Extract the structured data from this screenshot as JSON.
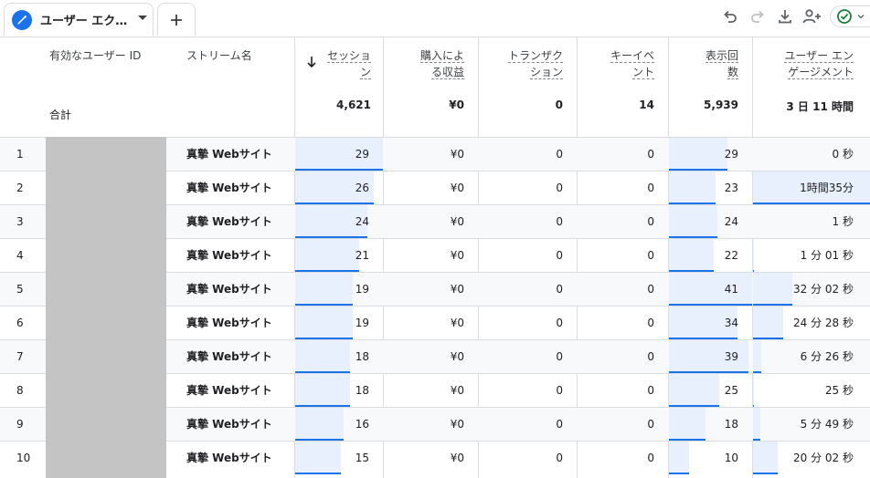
{
  "tab": {
    "label": "ユーザー エク…",
    "add_label": "+"
  },
  "toolbar": {
    "icons": [
      "undo-icon",
      "redo-icon",
      "download-icon",
      "share-user-icon",
      "check-circle-icon"
    ]
  },
  "colors": {
    "accent": "#1a73e8",
    "bar_fill": "#e8f0fe",
    "grid": "#dadce0",
    "redact": "#c4c4c4",
    "check": "#188038"
  },
  "headers": {
    "user_id": "有効なユーザー ID",
    "stream": "ストリーム名",
    "sessions": [
      "セッショ",
      "ン"
    ],
    "revenue": [
      "購入によ",
      "る収益"
    ],
    "transactions": [
      "トランザク",
      "ション"
    ],
    "key_events": [
      "キーイベ",
      "ント"
    ],
    "views": [
      "表示回",
      "数"
    ],
    "engagement": [
      "ユーザー エン",
      "ゲージメント"
    ]
  },
  "totals": {
    "label": "合計",
    "sessions": "4,621",
    "revenue": "¥0",
    "transactions": "0",
    "key_events": "14",
    "views": "5,939",
    "engagement": "3 日 11 時間"
  },
  "rows": [
    {
      "index": "1",
      "stream": "真摯 Webサイト",
      "sessions": "29",
      "revenue": "¥0",
      "transactions": "0",
      "key_events": "0",
      "views": "29",
      "engagement": "0 秒",
      "sessions_n": 29,
      "views_n": 29,
      "engagement_sec": 0
    },
    {
      "index": "2",
      "stream": "真摯 Webサイト",
      "sessions": "26",
      "revenue": "¥0",
      "transactions": "0",
      "key_events": "0",
      "views": "23",
      "engagement": "1時間35分",
      "sessions_n": 26,
      "views_n": 23,
      "engagement_sec": 5700
    },
    {
      "index": "3",
      "stream": "真摯 Webサイト",
      "sessions": "24",
      "revenue": "¥0",
      "transactions": "0",
      "key_events": "0",
      "views": "24",
      "engagement": "1 秒",
      "sessions_n": 24,
      "views_n": 24,
      "engagement_sec": 1
    },
    {
      "index": "4",
      "stream": "真摯 Webサイト",
      "sessions": "21",
      "revenue": "¥0",
      "transactions": "0",
      "key_events": "0",
      "views": "22",
      "engagement": "1 分 01 秒",
      "sessions_n": 21,
      "views_n": 22,
      "engagement_sec": 61
    },
    {
      "index": "5",
      "stream": "真摯 Webサイト",
      "sessions": "19",
      "revenue": "¥0",
      "transactions": "0",
      "key_events": "0",
      "views": "41",
      "engagement": "32 分 02 秒",
      "sessions_n": 19,
      "views_n": 41,
      "engagement_sec": 1922
    },
    {
      "index": "6",
      "stream": "真摯 Webサイト",
      "sessions": "19",
      "revenue": "¥0",
      "transactions": "0",
      "key_events": "0",
      "views": "34",
      "engagement": "24 分 28 秒",
      "sessions_n": 19,
      "views_n": 34,
      "engagement_sec": 1468
    },
    {
      "index": "7",
      "stream": "真摯 Webサイト",
      "sessions": "18",
      "revenue": "¥0",
      "transactions": "0",
      "key_events": "0",
      "views": "39",
      "engagement": "6 分 26 秒",
      "sessions_n": 18,
      "views_n": 39,
      "engagement_sec": 386
    },
    {
      "index": "8",
      "stream": "真摯 Webサイト",
      "sessions": "18",
      "revenue": "¥0",
      "transactions": "0",
      "key_events": "0",
      "views": "25",
      "engagement": "25 秒",
      "sessions_n": 18,
      "views_n": 25,
      "engagement_sec": 25
    },
    {
      "index": "9",
      "stream": "真摯 Webサイト",
      "sessions": "16",
      "revenue": "¥0",
      "transactions": "0",
      "key_events": "0",
      "views": "18",
      "engagement": "5 分 49 秒",
      "sessions_n": 16,
      "views_n": 18,
      "engagement_sec": 349
    },
    {
      "index": "10",
      "stream": "真摯 Webサイト",
      "sessions": "15",
      "revenue": "¥0",
      "transactions": "0",
      "key_events": "0",
      "views": "10",
      "engagement": "20 分 02 秒",
      "sessions_n": 15,
      "views_n": 10,
      "engagement_sec": 1202
    }
  ]
}
